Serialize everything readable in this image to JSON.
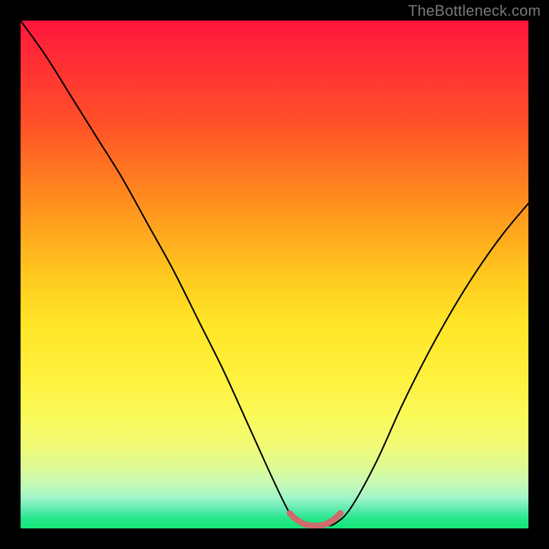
{
  "watermark": "TheBottleneck.com",
  "chart_data": {
    "type": "line",
    "title": "",
    "xlabel": "",
    "ylabel": "",
    "xlim": [
      0,
      100
    ],
    "ylim": [
      0,
      100
    ],
    "grid": false,
    "legend": false,
    "series": [
      {
        "name": "bottleneck-curve",
        "color": "#000000",
        "x": [
          0,
          5,
          10,
          15,
          20,
          25,
          30,
          35,
          40,
          45,
          50,
          53,
          55,
          58,
          60,
          62,
          65,
          70,
          75,
          80,
          85,
          90,
          95,
          100
        ],
        "y": [
          100,
          93,
          85,
          77,
          69,
          60,
          51,
          41,
          31,
          20,
          9,
          3,
          1,
          0.5,
          0.5,
          1,
          4,
          13,
          24,
          34,
          43,
          51,
          58,
          64
        ]
      },
      {
        "name": "sweet-spot-marker",
        "color": "#cf6b6b",
        "x": [
          53,
          54,
          55,
          56,
          57,
          58,
          59,
          60,
          61,
          62,
          63
        ],
        "y": [
          3,
          2,
          1.3,
          0.8,
          0.6,
          0.5,
          0.6,
          0.8,
          1.3,
          2,
          3
        ]
      }
    ],
    "background_gradient_stops": [
      {
        "pos": 0,
        "color": "#ff143c"
      },
      {
        "pos": 20,
        "color": "#ff5028"
      },
      {
        "pos": 40,
        "color": "#ffb41e"
      },
      {
        "pos": 60,
        "color": "#ffe628"
      },
      {
        "pos": 80,
        "color": "#f0fa78"
      },
      {
        "pos": 95,
        "color": "#64ebb4"
      },
      {
        "pos": 100,
        "color": "#14e678"
      }
    ],
    "notes": "V-shaped bottleneck curve over a red-to-green vertical gradient. Y runs 0–100 with 0 at bottom. Minimum around x≈58. Pink marker hugs the trough."
  }
}
